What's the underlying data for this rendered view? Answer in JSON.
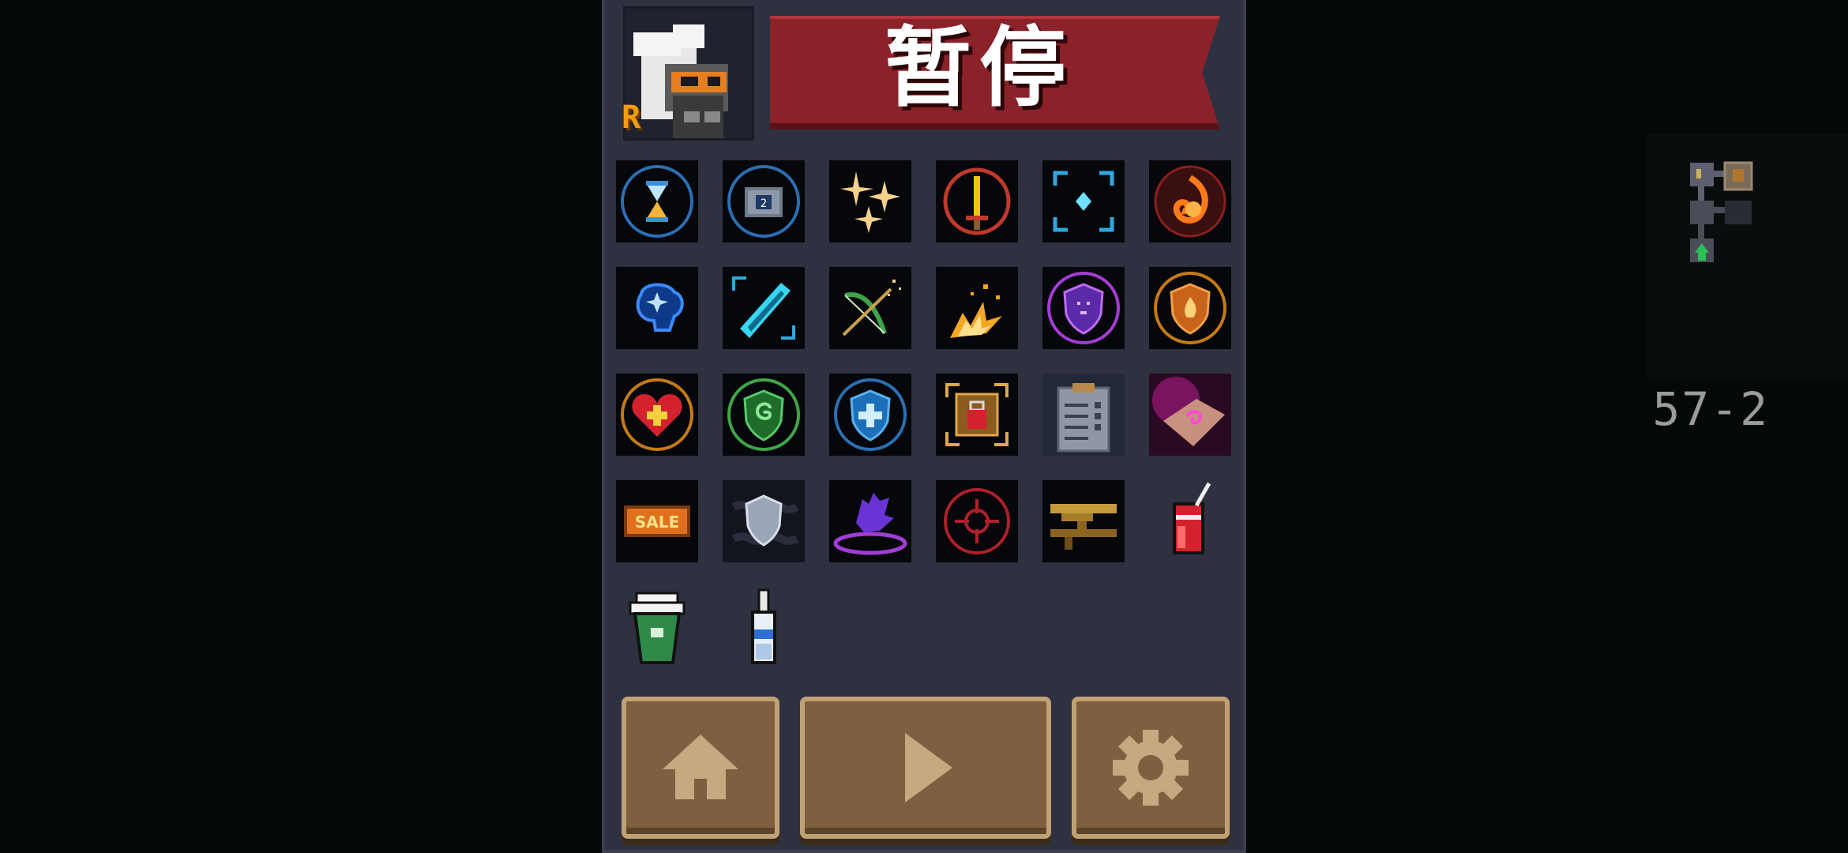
{
  "pause_menu": {
    "title": "暂停",
    "character": {
      "rank_badge": "R",
      "name_icon": "white-haired-knight-portrait"
    },
    "buffs": [
      {
        "icon": "hourglass-icon"
      },
      {
        "icon": "chest-2-icon"
      },
      {
        "icon": "sparkles-icon"
      },
      {
        "icon": "sword-circle-icon"
      },
      {
        "icon": "target-frame-diamond-icon"
      },
      {
        "icon": "fire-swirl-icon"
      },
      {
        "icon": "blue-brain-icon"
      },
      {
        "icon": "cyan-blade-icon"
      },
      {
        "icon": "green-bow-icon"
      },
      {
        "icon": "explosion-spark-icon"
      },
      {
        "icon": "purple-shield-icon"
      },
      {
        "icon": "fire-shield-icon"
      },
      {
        "icon": "heart-plus-icon"
      },
      {
        "icon": "green-swirl-shield-icon"
      },
      {
        "icon": "blue-cross-shield-icon"
      },
      {
        "icon": "potion-lock-icon"
      },
      {
        "icon": "clipboard-checklist-icon"
      },
      {
        "icon": "magic-scroll-icon"
      },
      {
        "icon": "sale-sign-icon",
        "label": "SALE"
      },
      {
        "icon": "silver-shield-icon"
      },
      {
        "icon": "purple-hand-portal-icon"
      },
      {
        "icon": "red-crosshair-icon"
      },
      {
        "icon": "golden-rifle-icon"
      }
    ],
    "consumables": [
      {
        "icon": "red-soda-can-icon"
      },
      {
        "icon": "green-cup-icon"
      },
      {
        "icon": "water-bottle-icon"
      }
    ],
    "buttons": {
      "home": "home-icon",
      "resume": "play-icon",
      "settings": "gear-icon"
    }
  },
  "hud": {
    "level": "57-2"
  }
}
